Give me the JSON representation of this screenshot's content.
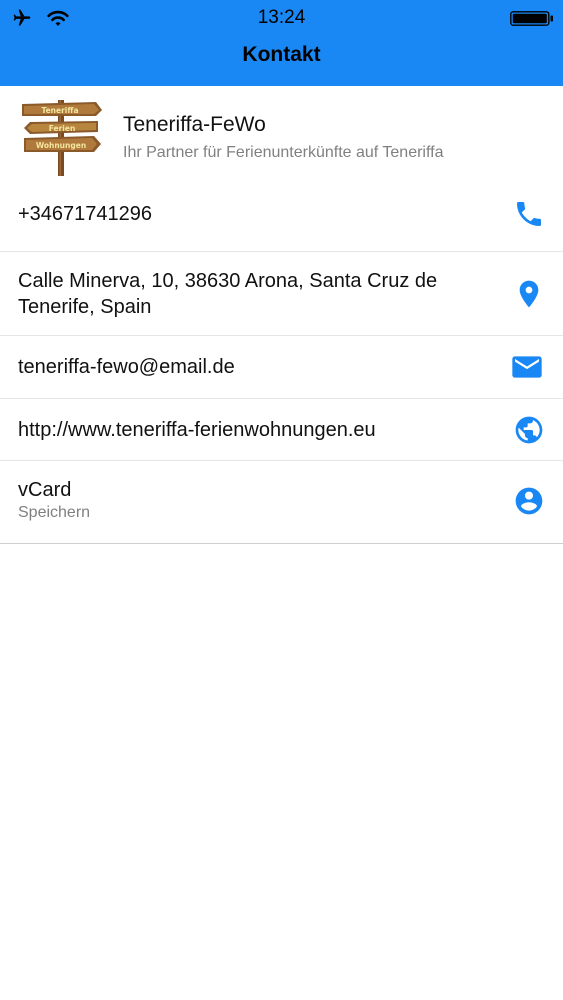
{
  "status": {
    "time": "13:24",
    "airplane_icon": "airplane-icon",
    "wifi_icon": "wifi-icon",
    "battery_icon": "battery-icon"
  },
  "nav": {
    "title": "Kontakt"
  },
  "company": {
    "name": "Teneriffa-FeWo",
    "tagline": "Ihr Partner für Ferienunterkünfte auf Teneriffa",
    "logo_text": [
      "Teneriffa",
      "Ferien",
      "Wohnungen"
    ]
  },
  "contacts": {
    "phone": "+34671741296",
    "address_line1": "Calle Minerva, 10, 38630 Arona, Santa Cruz de",
    "address_line2": "Tenerife, Spain",
    "email": "teneriffa-fewo@email.de",
    "website": "http://www.teneriffa-ferienwohnungen.eu",
    "vcard_title": "vCard",
    "vcard_sub": "Speichern"
  },
  "colors": {
    "header": "#1a88f4",
    "accent": "#1a88f4",
    "text": "#111111",
    "secondary": "#808080"
  }
}
